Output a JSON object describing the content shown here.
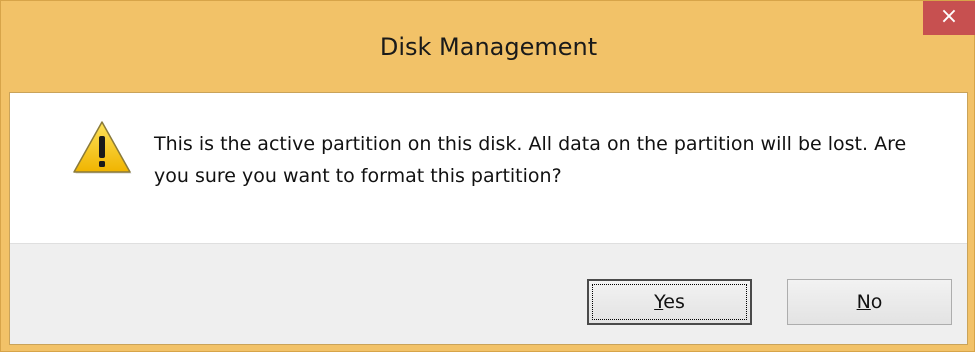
{
  "window": {
    "title": "Disk Management",
    "close_glyph": "×",
    "close_icon": "close-icon"
  },
  "dialog": {
    "icon": "warning-icon",
    "message": "This is the active partition on this disk. All data on the partition will be lost. Are you sure you want to format this partition?"
  },
  "buttons": {
    "yes": {
      "mnemonic": "Y",
      "rest": "es"
    },
    "no": {
      "mnemonic": "N",
      "rest": "o"
    }
  },
  "colors": {
    "title_bar": "#f2c268",
    "close_button": "#c75050",
    "footer": "#efefef",
    "warning_fill": "#f7c90d"
  }
}
